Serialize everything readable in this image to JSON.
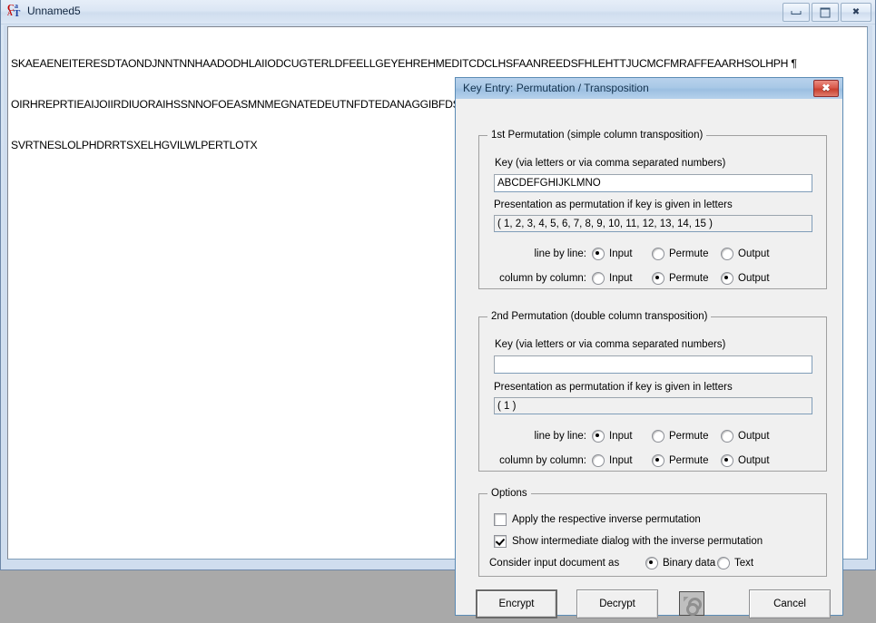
{
  "window": {
    "title": "Unnamed5",
    "icon": "cryptool-icon",
    "buttons": {
      "minimize": "minimize-icon",
      "maximize": "maximize-icon",
      "close": "close-icon"
    }
  },
  "document": {
    "lines": [
      "SKAEAENEITERESDTAONDJNNTNNHAADODHLAIIODCUGTERLDFEELLGEYEHREHMEDITCDCLHSFAANREEDSFHLEHTTJUCMCFMRAFFEAARHSOLHPH ¶",
      "OIRHREPRTIEAIJOIIRDIUORAIHSSNNOFOEASMNMEGNATEDEUTNFDTEDANAGGIBFDSHSCAONRHTNWAARAITEWHYFTEUPWAINAINISAANAADNAORN ¶",
      "SVRTNESLOLPHDRRTSXELHGVILWLPERTLOTX"
    ]
  },
  "dialog": {
    "title": "Key Entry: Permutation / Transposition",
    "close_label": "✖",
    "perm1": {
      "legend": "1st Permutation (simple column transposition)",
      "key_label": "Key (via letters or via comma separated numbers)",
      "key_value": "ABCDEFGHIJKLMNO",
      "presentation_label": "Presentation as permutation if key is given in letters",
      "presentation_value": "( 1, 2, 3, 4, 5, 6, 7, 8, 9, 10, 11, 12, 13, 14, 15 )",
      "row1_label": "line by line:",
      "row2_label": "column by column:",
      "options": [
        "Input",
        "Permute",
        "Output"
      ],
      "row1_selected": "Input",
      "row2_selected": [
        "Permute",
        "Output"
      ]
    },
    "perm2": {
      "legend": "2nd Permutation (double column transposition)",
      "key_label": "Key (via letters or via comma separated numbers)",
      "key_value": "",
      "presentation_label": "Presentation as permutation if key is given in letters",
      "presentation_value": "( 1 )",
      "row1_label": "line by line:",
      "row2_label": "column by column:",
      "options": [
        "Input",
        "Permute",
        "Output"
      ],
      "row1_selected": "Input",
      "row2_selected": [
        "Permute",
        "Output"
      ]
    },
    "options": {
      "legend": "Options",
      "inverse_label": "Apply the respective inverse permutation",
      "inverse_checked": false,
      "intermediate_label": "Show intermediate dialog with the inverse permutation",
      "intermediate_checked": true,
      "consider_label": "Consider input document as",
      "consider_options": [
        "Binary data",
        "Text"
      ],
      "consider_selected": "Binary data"
    },
    "buttons": {
      "encrypt": "Encrypt",
      "decrypt": "Decrypt",
      "help_icon": "key-icon",
      "cancel": "Cancel"
    }
  },
  "colors": {
    "desktop": "#a9a9a9",
    "window_chrome": "#cfddee",
    "dialog_title": "#a9c8e6",
    "dialog_face": "#f0f0f0",
    "close_button": "#c9402f"
  }
}
